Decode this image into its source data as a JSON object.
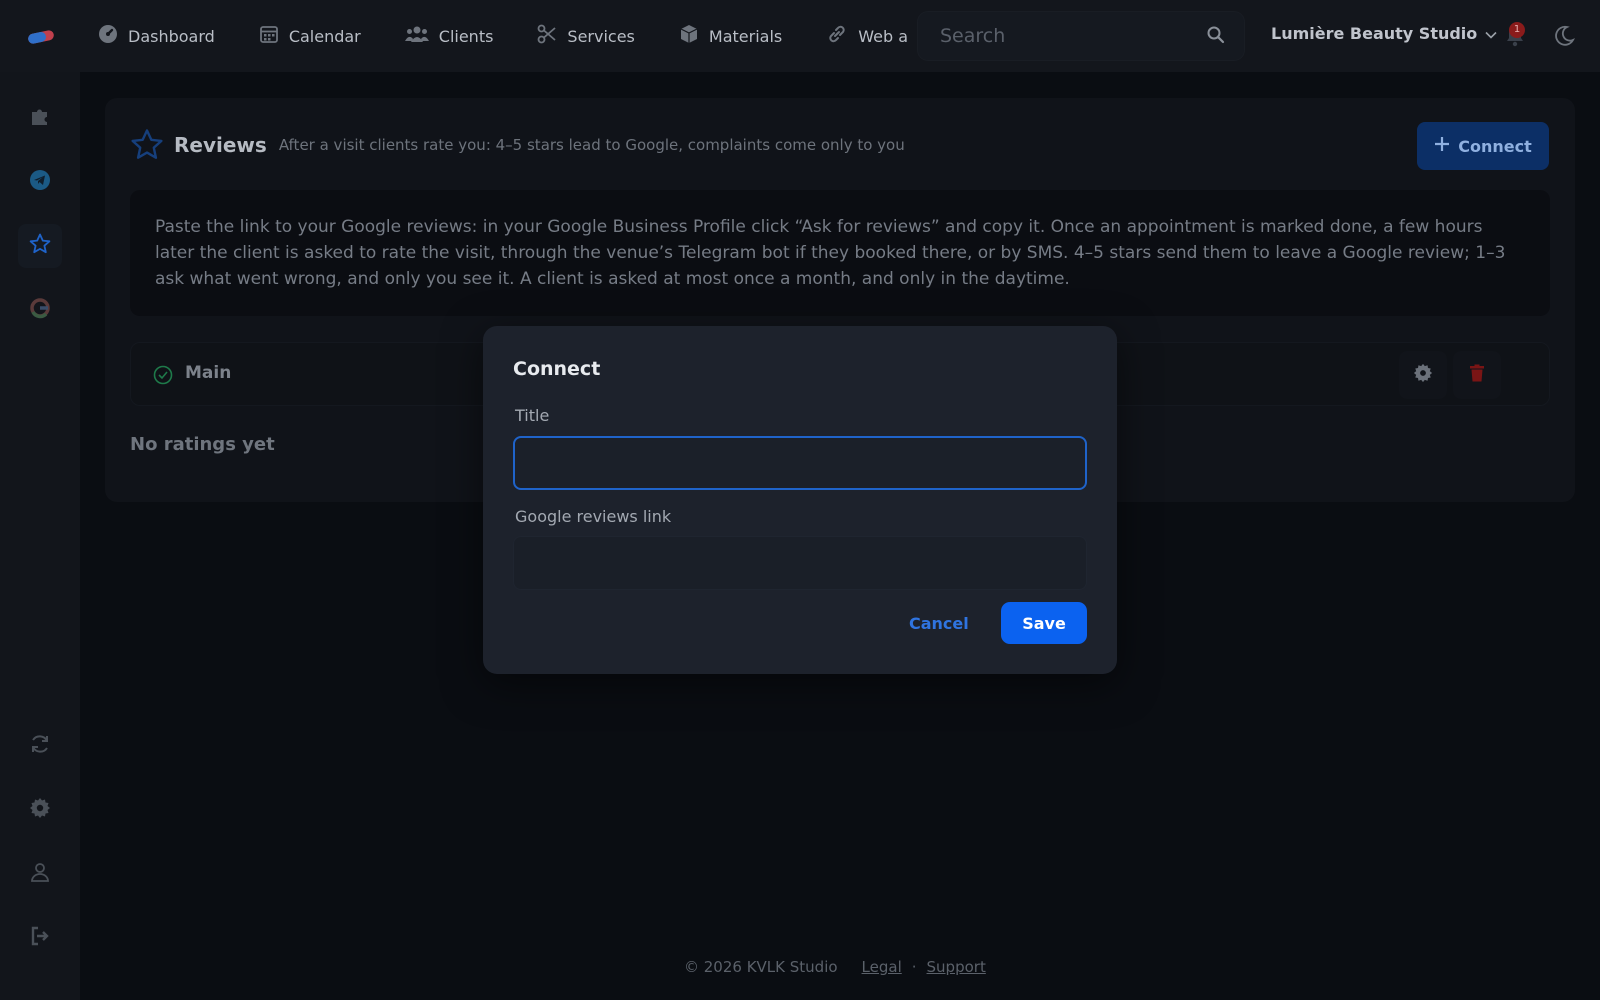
{
  "topbar": {
    "logo_icon": "app-logo",
    "nav": [
      {
        "label": "Dashboard",
        "icon": "dashboard-icon"
      },
      {
        "label": "Calendar",
        "icon": "calendar-icon"
      },
      {
        "label": "Clients",
        "icon": "clients-icon"
      },
      {
        "label": "Services",
        "icon": "scissors-icon"
      },
      {
        "label": "Materials",
        "icon": "box-icon"
      },
      {
        "label": "Web a",
        "icon": "link-icon"
      }
    ],
    "search": {
      "placeholder": "Search",
      "value": ""
    },
    "studio_name": "Lumière Beauty Studio",
    "notifications_count": "1"
  },
  "sidebar": {
    "items": [
      {
        "icon": "puzzle-icon"
      },
      {
        "icon": "telegram-icon"
      },
      {
        "icon": "star-icon",
        "active": true
      },
      {
        "icon": "google-icon"
      },
      {
        "icon": "sync-icon"
      },
      {
        "icon": "gear-icon"
      },
      {
        "icon": "user-icon"
      },
      {
        "icon": "logout-icon"
      }
    ]
  },
  "reviews": {
    "title": "Reviews",
    "subtitle": "After a visit clients rate you: 4–5 stars lead to Google, complaints come only to you",
    "connect_label": "Connect",
    "info": "Paste the link to your Google reviews: in your Google Business Profile click “Ask for reviews” and copy it. Once an appointment is marked done, a few hours later the client is asked to rate the visit, through the venue’s Telegram bot if they booked there, or by SMS. 4–5 stars send them to leave a Google review; 1–3 ask what went wrong, and only you see it. A client is asked at most once a month, and only in the daytime.",
    "row": {
      "label": "Main"
    },
    "empty_text": "No ratings yet"
  },
  "modal": {
    "title": "Connect",
    "title_field_label": "Title",
    "title_field_value": "",
    "link_field_label": "Google reviews link",
    "link_field_value": "",
    "cancel_label": "Cancel",
    "save_label": "Save"
  },
  "footer": {
    "copyright": "© 2026 KVLK Studio",
    "legal": "Legal",
    "separator": "·",
    "support": "Support"
  },
  "colors": {
    "accent": "#0b62f0",
    "background": "#0a0d12",
    "modal": "#1d222c",
    "danger": "#c2201f",
    "success": "#1e9a5a"
  }
}
